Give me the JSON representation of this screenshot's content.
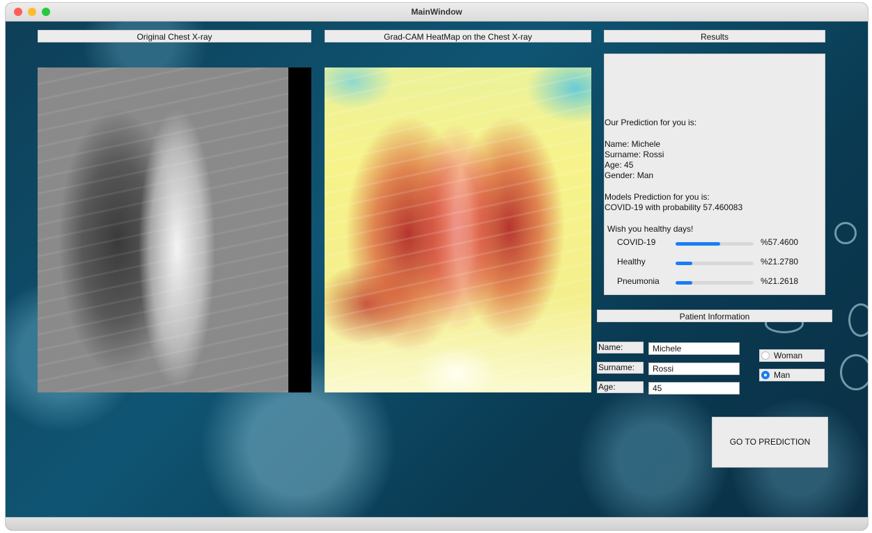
{
  "window": {
    "title": "MainWindow"
  },
  "panels": {
    "original_header": "Original Chest X-ray",
    "heatmap_header": "Grad-CAM HeatMap on the Chest X-ray",
    "results_header": "Results"
  },
  "results": {
    "intro": "Our Prediction for you is:",
    "name_line": "Name:  Michele",
    "surname_line": "Surname:  Rossi",
    "age_line": "Age: 45",
    "gender_line": "Gender:  Man",
    "models_line": "Models Prediction for you is:",
    "prediction_line": "COVID-19 with probability 57.460083",
    "wish_line": "Wish you healthy days!",
    "bars": [
      {
        "label": "COVID-19",
        "fraction": 0.5746,
        "pct": "%57.4600"
      },
      {
        "label": "Healthy",
        "fraction": 0.2128,
        "pct": "%21.2780"
      },
      {
        "label": "Pneumonia",
        "fraction": 0.2126,
        "pct": "%21.2618"
      }
    ],
    "bar_color": "#1a7cf5"
  },
  "patient": {
    "header": "Patient Information",
    "name_label": "Name:",
    "name_value": "Michele",
    "surname_label": "Surname:",
    "surname_value": "Rossi",
    "age_label": "Age:",
    "age_value": "45",
    "gender_options": [
      "Woman",
      "Man"
    ],
    "gender_selected": "Man"
  },
  "actions": {
    "predict_label": "GO TO PREDICTION"
  }
}
